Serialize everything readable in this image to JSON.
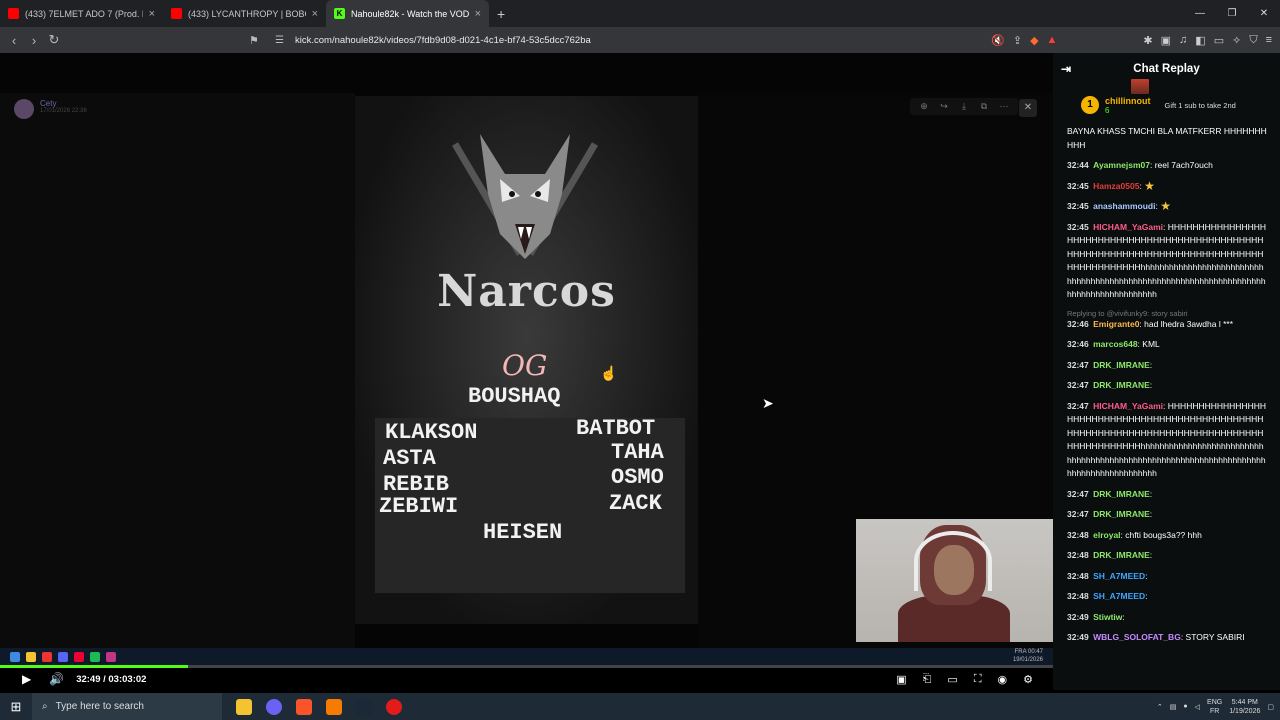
{
  "browser": {
    "tabs": [
      {
        "title": "(433) 7ELMET ADO 7 (Prod. By W",
        "active": false,
        "favicon_color": "#ff0000"
      },
      {
        "title": "(433) LYCANTHROPY | BOBONY RP",
        "active": false,
        "favicon_color": "#ff0000"
      },
      {
        "title": "Nahoule82k - Watch the VOD on",
        "active": true,
        "favicon_color": "#53fc18"
      }
    ],
    "new_tab": "+",
    "url": "kick.com/nahoule82k/videos/7fdb9d08-d021-4c1e-bf74-53c5dcc762ba"
  },
  "stream": {
    "streamer_name": "Cety",
    "streamer_date": "17/01/2026 22:36"
  },
  "poster": {
    "title": "Narcos",
    "subtitle": "OG",
    "leader": "BOUSHAQ",
    "left_names": [
      "KLAKSON",
      "ASTA",
      "REBIB",
      "ZEBIWI"
    ],
    "right_names": [
      "BATBOT",
      "TAHA",
      "OSMO",
      "ZACK"
    ],
    "bottom_name": "HEISEN"
  },
  "inner_clock": {
    "time": "00:47",
    "date": "19/01/2026",
    "lang": "FRA"
  },
  "player": {
    "time": "32:49 / 03:03:02",
    "progress_fraction": 0.179,
    "accent": "#53fc18"
  },
  "chat": {
    "title": "Chat Replay",
    "pinned": {
      "rank": "1",
      "user": "chillinnout",
      "count": "6",
      "gift_text": "Gift 1 sub to take 2nd"
    },
    "messages": [
      {
        "time": "",
        "user": "",
        "color": "#ffffff",
        "text": "BAYNA KHASS TMCHI BLA MATFKERR HHHHHHHHHH"
      },
      {
        "time": "32:44",
        "user": "Ayamnejsm07",
        "color": "#8de96a",
        "text": "reel 7ach7ouch"
      },
      {
        "time": "32:45",
        "user": "Hamza0505",
        "color": "#e53b3b",
        "text": "",
        "emote": "star"
      },
      {
        "time": "32:45",
        "user": "anashammoudi",
        "color": "#a9c7ff",
        "text": "",
        "emote": "star"
      },
      {
        "time": "32:45",
        "user": "HICHAM_YaGami",
        "color": "#ff5c8a",
        "text": "HHHHHHHHHHHHHHHHHHHHHHHHHHHHHHHHHHHHHHHHHHHHHHHHHHHHHHHHHHHHHHHHHHHHHHHHHHHHHHHHHHHHHHHHHHHHhhhhhhhhhhhhhhhhhhhhhhhhhhhhhhhhhhhhhhhhhhhhhhhhhhhhhhhhhhhhhhhhhhhhhhhhhhhhhhhhhhhhhhh"
      },
      {
        "time": "32:46",
        "user": "Emigrante0",
        "color": "#ffb84d",
        "text": "had lhedra 3awdha l ***",
        "reply": "Replying to @vivifunky9: story sabiri"
      },
      {
        "time": "32:46",
        "user": "marcos648",
        "color": "#8de96a",
        "text": "KML"
      },
      {
        "time": "32:47",
        "user": "DRK_IMRANE",
        "color": "#8de96a",
        "text": "",
        "emote": "face"
      },
      {
        "time": "32:47",
        "user": "DRK_IMRANE",
        "color": "#8de96a",
        "text": "",
        "emote": "face"
      },
      {
        "time": "32:47",
        "user": "HICHAM_YaGami",
        "color": "#ff5c8a",
        "text": "HHHHHHHHHHHHHHHHHHHHHHHHHHHHHHHHHHHHHHHHHHHHHHHHHHHHHHHHHHHHHHHHHHHHHHHHHHHHHHHHHHHHHHHHHHHHhhhhhhhhhhhhhhhhhhhhhhhhhhhhhhhhhhhhhhhhhhhhhhhhhhhhhhhhhhhhhhhhhhhhhhhhhhhhhhhhhhhhhhh"
      },
      {
        "time": "32:47",
        "user": "DRK_IMRANE",
        "color": "#8de96a",
        "text": "",
        "emote": "face"
      },
      {
        "time": "32:47",
        "user": "DRK_IMRANE",
        "color": "#8de96a",
        "text": "",
        "emote": "face"
      },
      {
        "time": "32:48",
        "user": "elroyal",
        "color": "#8de96a",
        "text": "chfti bougs3a?? hhh"
      },
      {
        "time": "32:48",
        "user": "DRK_IMRANE",
        "color": "#8de96a",
        "text": "",
        "emote": "face"
      },
      {
        "time": "32:48",
        "user": "SH_A7MEED",
        "color": "#3ea6ff",
        "text": "",
        "emote": "face"
      },
      {
        "time": "32:48",
        "user": "SH_A7MEED",
        "color": "#3ea6ff",
        "text": "",
        "emote": "face"
      },
      {
        "time": "32:49",
        "user": "Stiwtiw",
        "color": "#8de96a",
        "text": "",
        "emote": "face"
      },
      {
        "time": "32:49",
        "user": "WBLG_SOLOFAT_BG",
        "color": "#c58bff",
        "text": "STORY SABIRI"
      }
    ]
  },
  "taskbar": {
    "search_placeholder": "Type here to search",
    "lang_top": "ENG",
    "lang_bottom": "FR",
    "time": "5:44 PM",
    "date": "1/19/2026"
  }
}
